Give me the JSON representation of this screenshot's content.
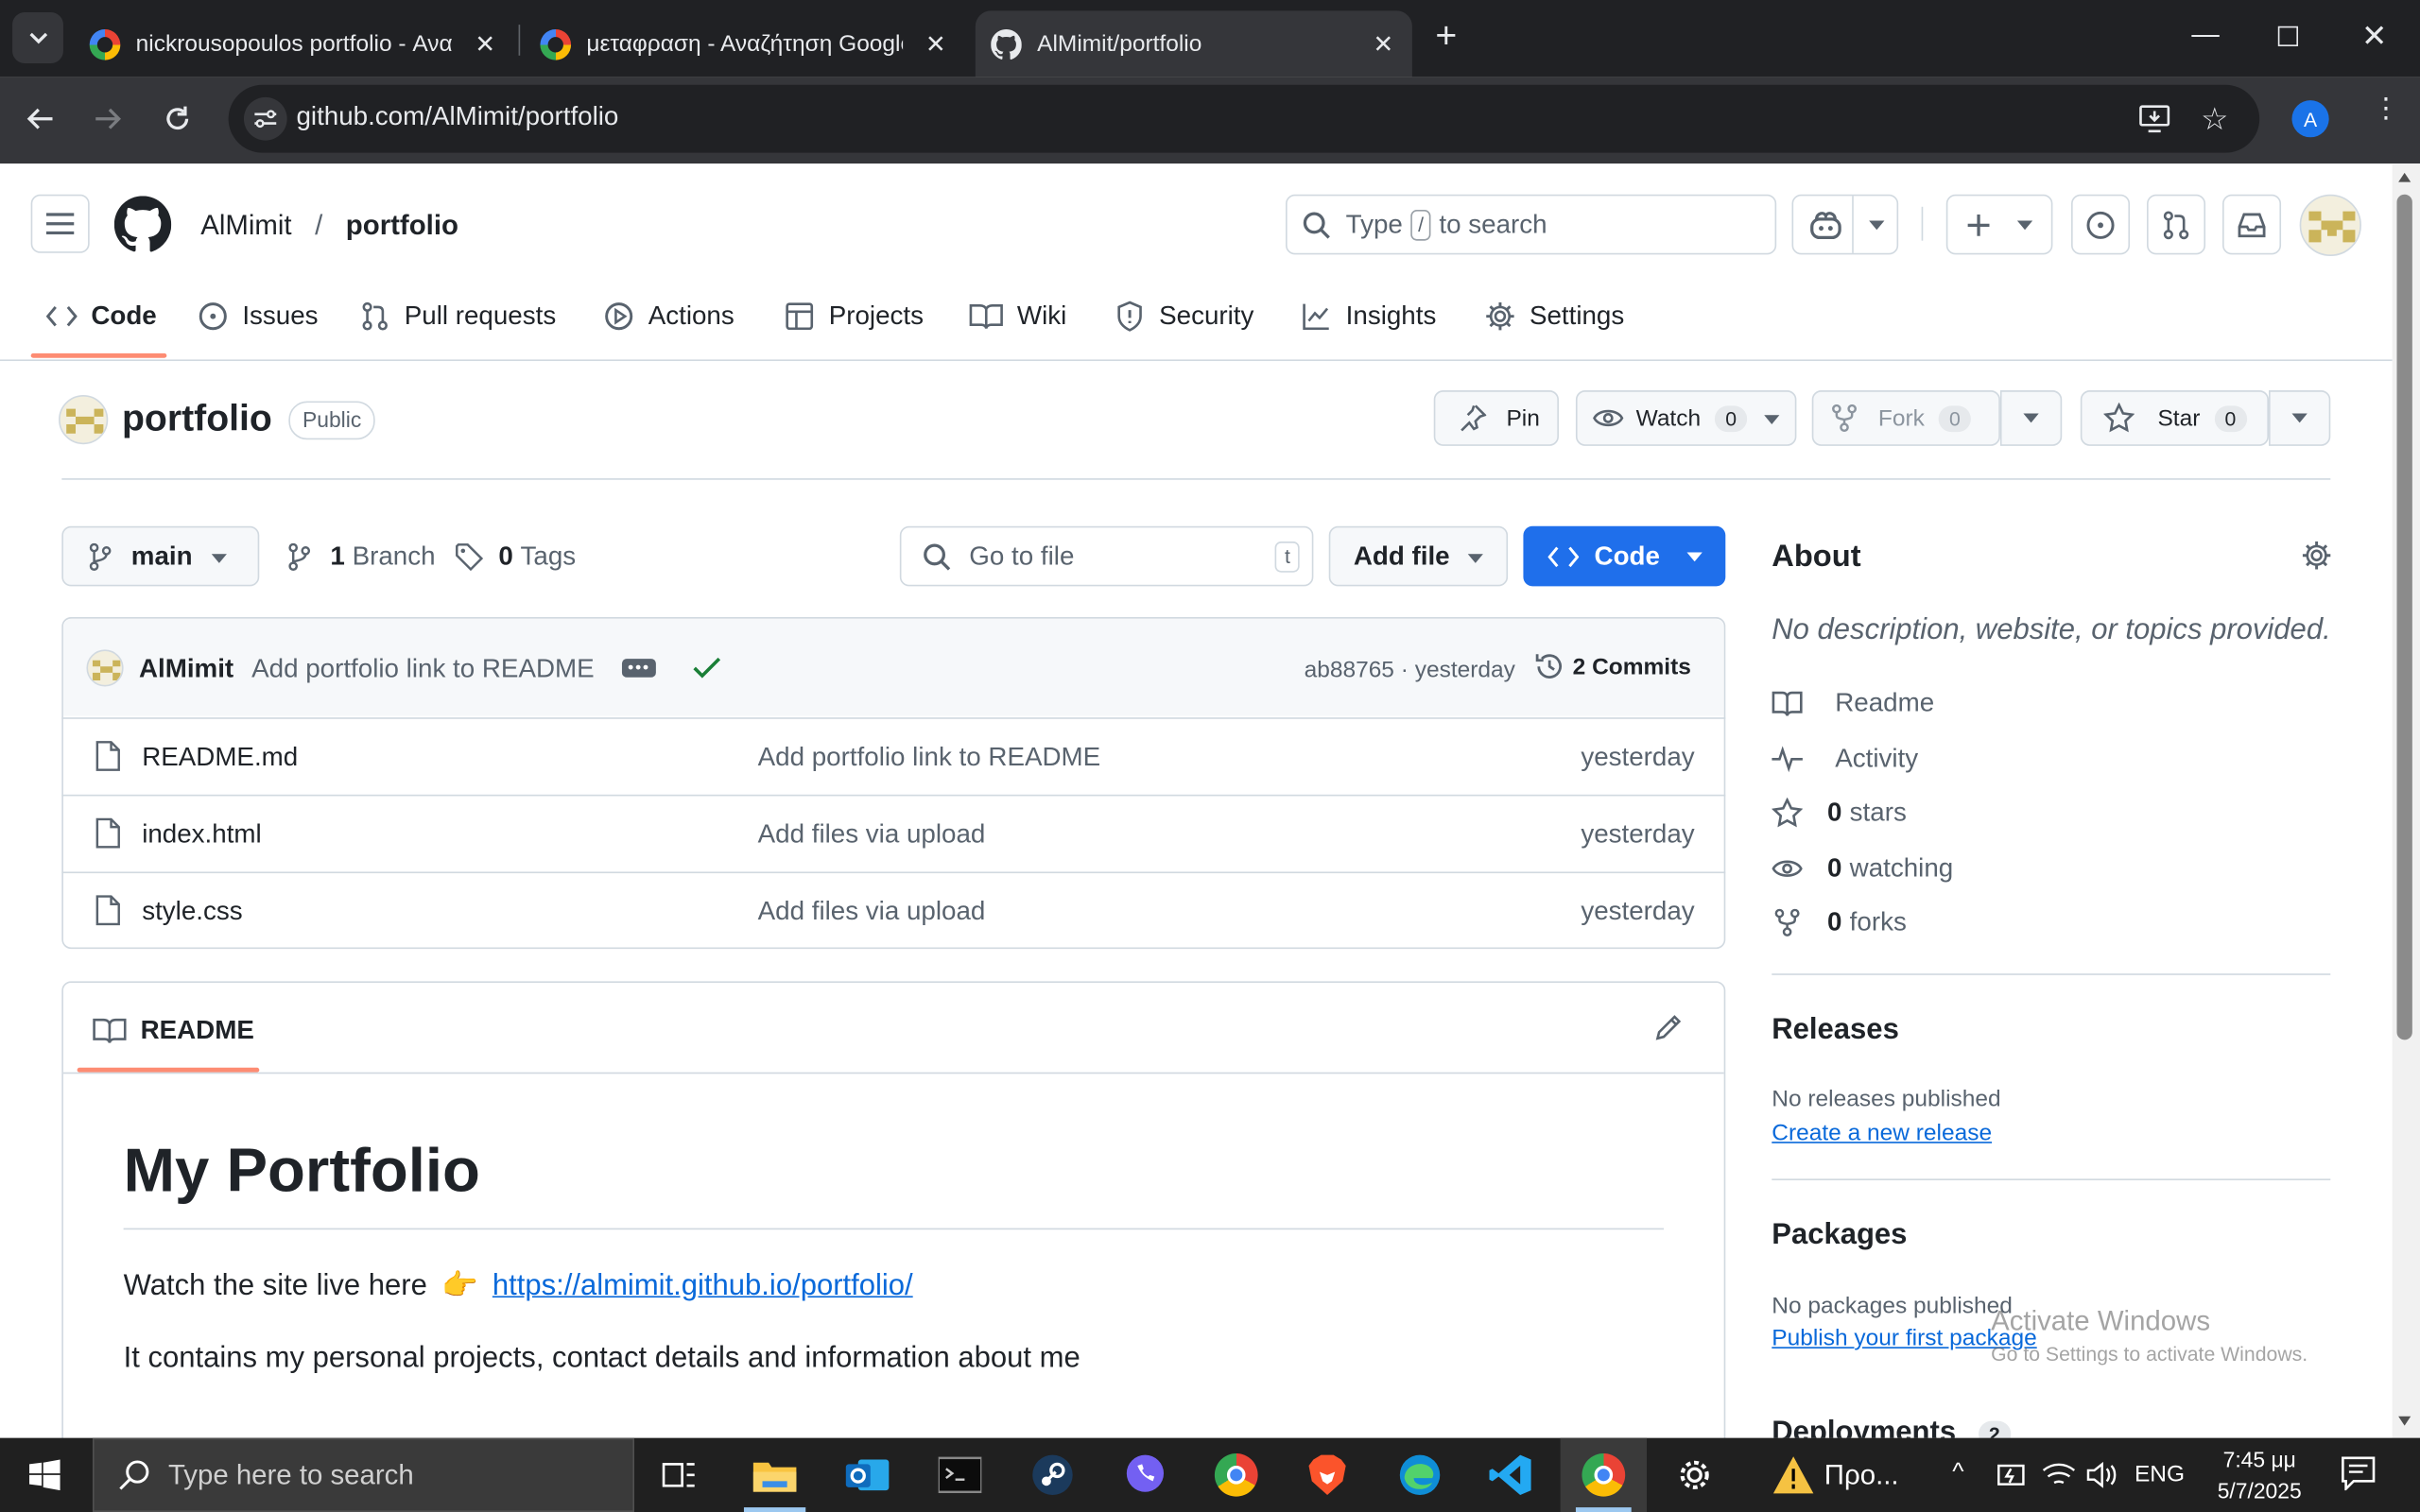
{
  "browser": {
    "tabs": [
      {
        "title": "nickrousopoulos portfolio - Αναζήτηση Google",
        "active": false
      },
      {
        "title": "μεταφραση - Αναζήτηση Google",
        "active": false
      },
      {
        "title": "AlMimit/portfolio",
        "active": true
      }
    ],
    "url": "github.com/AlMimit/portfolio",
    "profile_letter": "A"
  },
  "github": {
    "owner": "AlMimit",
    "sep": "/",
    "repo": "portfolio",
    "search_pre": "Type",
    "search_key": "/",
    "search_post": "to search",
    "nav": [
      "Code",
      "Issues",
      "Pull requests",
      "Actions",
      "Projects",
      "Wiki",
      "Security",
      "Insights",
      "Settings"
    ],
    "repo_title": "portfolio",
    "visibility": "Public",
    "pin": "Pin",
    "watch": "Watch",
    "watch_count": "0",
    "fork": "Fork",
    "fork_count": "0",
    "star": "Star",
    "star_count": "0",
    "branch": "main",
    "branches": "1",
    "branches_label": "Branch",
    "tags": "0",
    "tags_label": "Tags",
    "goto_file": "Go to file",
    "goto_key": "t",
    "add_file": "Add file",
    "code_btn": "Code",
    "commit": {
      "author": "AlMimit",
      "message": "Add portfolio link to README",
      "hash": "ab88765",
      "dot": "·",
      "when": "yesterday",
      "commits": "2 Commits"
    },
    "files": [
      {
        "name": "README.md",
        "msg": "Add portfolio link to README",
        "when": "yesterday"
      },
      {
        "name": "index.html",
        "msg": "Add files via upload",
        "when": "yesterday"
      },
      {
        "name": "style.css",
        "msg": "Add files via upload",
        "when": "yesterday"
      }
    ],
    "readme": {
      "tab": "README",
      "h1": "My Portfolio",
      "p1": "Watch the site live here",
      "emoji": "👉",
      "link": "https://almimit.github.io/portfolio/",
      "p2": "It contains my personal projects, contact details and information about me"
    },
    "about": {
      "title": "About",
      "desc": "No description, website, or topics provided.",
      "items": [
        {
          "n": "",
          "l": "Readme"
        },
        {
          "n": "",
          "l": "Activity"
        },
        {
          "n": "0",
          "l": "stars"
        },
        {
          "n": "0",
          "l": "watching"
        },
        {
          "n": "0",
          "l": "forks"
        }
      ]
    },
    "releases": {
      "title": "Releases",
      "none": "No releases published",
      "link": "Create a new release"
    },
    "packages": {
      "title": "Packages",
      "none": "No packages published",
      "link": "Publish your first package"
    },
    "deployments": {
      "title": "Deployments",
      "count": "2"
    },
    "watermark": {
      "l1": "Activate Windows",
      "l2": "Go to Settings to activate Windows."
    }
  },
  "taskbar": {
    "search": "Type here to search",
    "weather": "Προ...",
    "lang": "ENG",
    "time": "7:45 μμ",
    "date": "5/7/2025"
  },
  "colors": {
    "accent": "#0969da",
    "code_btn": "#1f6feb",
    "underline": "#fd8c73",
    "chrome_bg": "#202124"
  }
}
